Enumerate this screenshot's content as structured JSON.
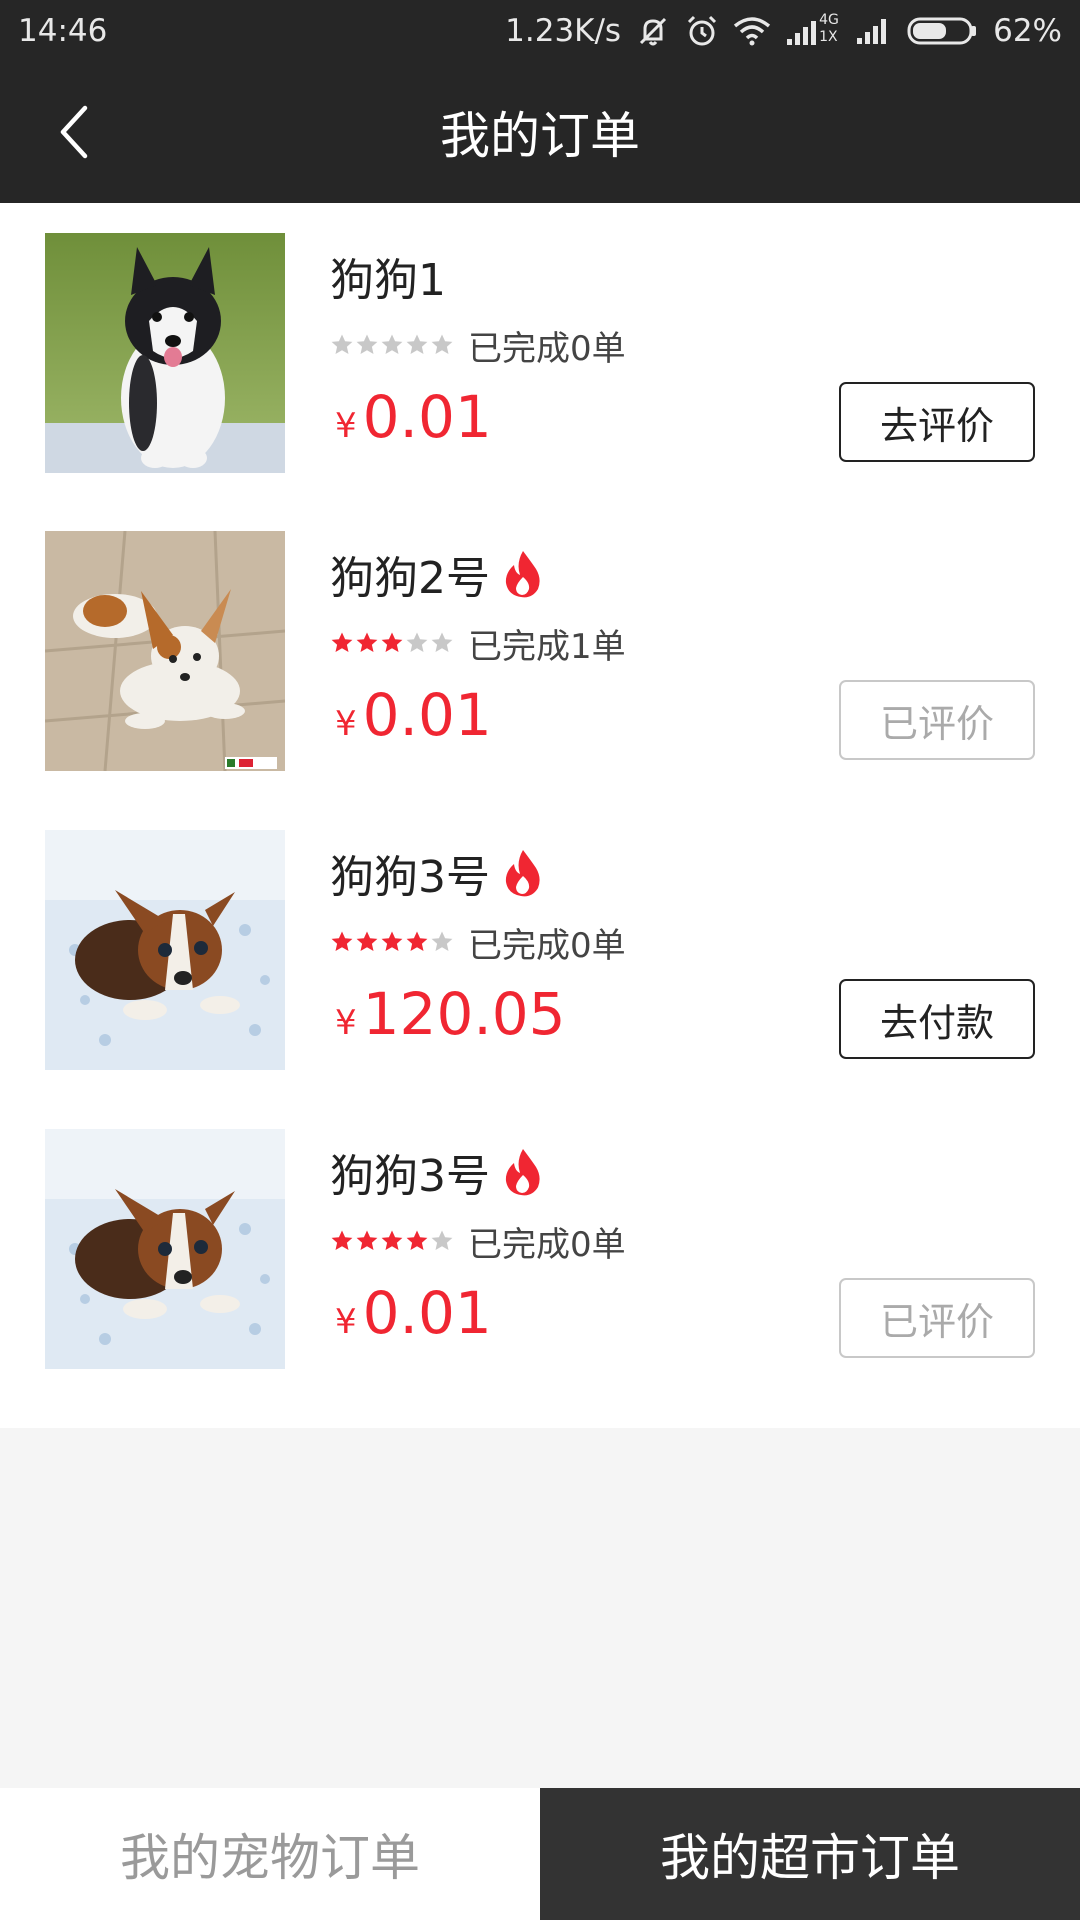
{
  "status_bar": {
    "time": "14:46",
    "net_speed": "1.23K/s",
    "network_label_top": "4G",
    "network_label_bottom": "1X",
    "battery": "62%",
    "battery_level": 0.62
  },
  "header": {
    "title": "我的订单"
  },
  "orders": [
    {
      "name": "狗狗1",
      "hot": false,
      "rating": 0,
      "rating_max": 5,
      "completed": "已完成0单",
      "currency": "¥",
      "price": "0.01",
      "action": "去评价",
      "action_enabled": true
    },
    {
      "name": "狗狗2号",
      "hot": true,
      "rating": 3,
      "rating_max": 5,
      "completed": "已完成1单",
      "currency": "¥",
      "price": "0.01",
      "action": "已评价",
      "action_enabled": false
    },
    {
      "name": "狗狗3号",
      "hot": true,
      "rating": 4,
      "rating_max": 5,
      "completed": "已完成0单",
      "currency": "¥",
      "price": "120.05",
      "action": "去付款",
      "action_enabled": true
    },
    {
      "name": "狗狗3号",
      "hot": true,
      "rating": 4,
      "rating_max": 5,
      "completed": "已完成0单",
      "currency": "¥",
      "price": "0.01",
      "action": "已评价",
      "action_enabled": false
    }
  ],
  "tabs": [
    {
      "label": "我的宠物订单",
      "active": false
    },
    {
      "label": "我的超市订单",
      "active": true
    }
  ],
  "colors": {
    "accent_red": "#f02632",
    "bar_dark": "#262626",
    "star_on": "#f02632",
    "star_off": "#c8c8c8"
  }
}
